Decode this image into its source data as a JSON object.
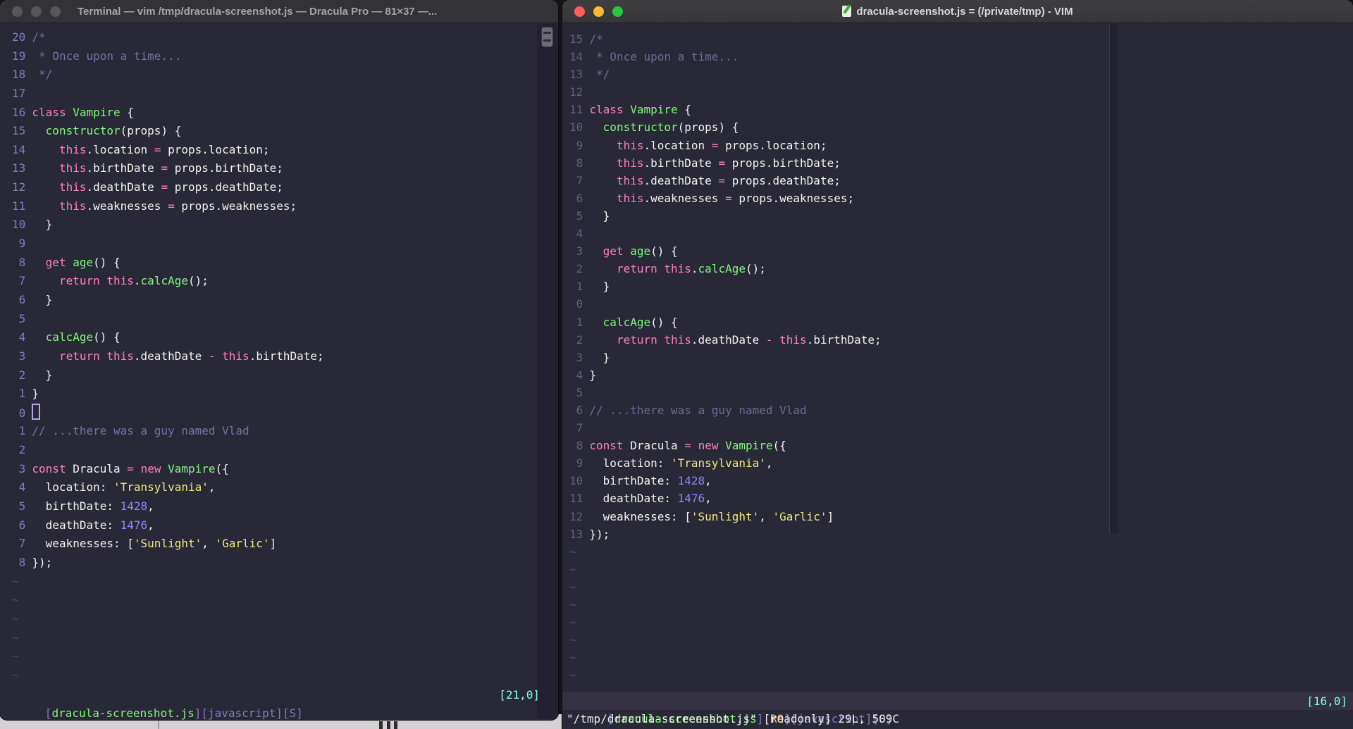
{
  "colors": {
    "background": "#292836",
    "foreground": "#F4F3EC",
    "pink": "#FF80BF",
    "green": "#82F77E",
    "yellow": "#EFEB7D",
    "purple_number": "#9580FF",
    "comment": "#7970A9",
    "cyan_ruler": "#80FFEA",
    "orange_readonly": "#FFCA80",
    "traffic_red": "#FF5F57",
    "traffic_yellow": "#FEBC2E",
    "traffic_green": "#28C840"
  },
  "code_lines": [
    [
      [
        "c",
        "/*"
      ]
    ],
    [
      [
        "c",
        " * Once upon a time..."
      ]
    ],
    [
      [
        "c",
        " */"
      ]
    ],
    [],
    [
      [
        "p",
        "class"
      ],
      [
        "f",
        " "
      ],
      [
        "g",
        "Vampire"
      ],
      [
        "f",
        " {"
      ]
    ],
    [
      [
        "f",
        "  "
      ],
      [
        "g",
        "constructor"
      ],
      [
        "f",
        "(props) {"
      ]
    ],
    [
      [
        "f",
        "    "
      ],
      [
        "p",
        "this"
      ],
      [
        "f",
        ".location "
      ],
      [
        "p",
        "="
      ],
      [
        "f",
        " props.location;"
      ]
    ],
    [
      [
        "f",
        "    "
      ],
      [
        "p",
        "this"
      ],
      [
        "f",
        ".birthDate "
      ],
      [
        "p",
        "="
      ],
      [
        "f",
        " props.birthDate;"
      ]
    ],
    [
      [
        "f",
        "    "
      ],
      [
        "p",
        "this"
      ],
      [
        "f",
        ".deathDate "
      ],
      [
        "p",
        "="
      ],
      [
        "f",
        " props.deathDate;"
      ]
    ],
    [
      [
        "f",
        "    "
      ],
      [
        "p",
        "this"
      ],
      [
        "f",
        ".weaknesses "
      ],
      [
        "p",
        "="
      ],
      [
        "f",
        " props.weaknesses;"
      ]
    ],
    [
      [
        "f",
        "  }"
      ]
    ],
    [],
    [
      [
        "f",
        "  "
      ],
      [
        "p",
        "get"
      ],
      [
        "f",
        " "
      ],
      [
        "g",
        "age"
      ],
      [
        "f",
        "() {"
      ]
    ],
    [
      [
        "f",
        "    "
      ],
      [
        "p",
        "return"
      ],
      [
        "f",
        " "
      ],
      [
        "p",
        "this"
      ],
      [
        "f",
        "."
      ],
      [
        "g",
        "calcAge"
      ],
      [
        "f",
        "();"
      ]
    ],
    [
      [
        "f",
        "  }"
      ]
    ],
    [],
    [
      [
        "f",
        "  "
      ],
      [
        "g",
        "calcAge"
      ],
      [
        "f",
        "() {"
      ]
    ],
    [
      [
        "f",
        "    "
      ],
      [
        "p",
        "return"
      ],
      [
        "f",
        " "
      ],
      [
        "p",
        "this"
      ],
      [
        "f",
        ".deathDate "
      ],
      [
        "p",
        "-"
      ],
      [
        "f",
        " "
      ],
      [
        "p",
        "this"
      ],
      [
        "f",
        ".birthDate;"
      ]
    ],
    [
      [
        "f",
        "  }"
      ]
    ],
    [
      [
        "f",
        "}"
      ]
    ],
    [],
    [
      [
        "c",
        "// ...there was a guy named Vlad"
      ]
    ],
    [],
    [
      [
        "p",
        "const"
      ],
      [
        "f",
        " Dracula "
      ],
      [
        "p",
        "="
      ],
      [
        "f",
        " "
      ],
      [
        "p",
        "new"
      ],
      [
        "f",
        " "
      ],
      [
        "g",
        "Vampire"
      ],
      [
        "f",
        "({"
      ]
    ],
    [
      [
        "f",
        "  location: "
      ],
      [
        "y",
        "'Transylvania'"
      ],
      [
        "f",
        ","
      ]
    ],
    [
      [
        "f",
        "  birthDate: "
      ],
      [
        "n",
        "1428"
      ],
      [
        "f",
        ","
      ]
    ],
    [
      [
        "f",
        "  deathDate: "
      ],
      [
        "n",
        "1476"
      ],
      [
        "f",
        ","
      ]
    ],
    [
      [
        "f",
        "  weaknesses: ["
      ],
      [
        "y",
        "'Sunlight'"
      ],
      [
        "f",
        ", "
      ],
      [
        "y",
        "'Garlic'"
      ],
      [
        "f",
        "]"
      ]
    ],
    [
      [
        "f",
        "});"
      ]
    ]
  ],
  "left_window": {
    "title": "Terminal — vim /tmp/dracula-screenshot.js — Dracula Pro — 81×37 —...",
    "cursor_file_line": 21,
    "show_cursor": true,
    "tilde_count": 6,
    "status_tokens": [
      [
        "b",
        "["
      ],
      [
        "g",
        "dracula-screenshot.js"
      ],
      [
        "b",
        "]["
      ],
      [
        "j",
        "javascript"
      ],
      [
        "b",
        "]["
      ],
      [
        "j",
        "S"
      ],
      [
        "b",
        "]"
      ]
    ],
    "ruler_tokens": [
      [
        "cy",
        "[21,0]"
      ]
    ],
    "cmdline": ""
  },
  "right_window": {
    "title": "dracula-screenshot.js = (/private/tmp) - VIM",
    "cursor_file_line": 16,
    "show_cursor": false,
    "tilde_count": 8,
    "status_tokens": [
      [
        "b",
        "["
      ],
      [
        "g",
        "dracula-screenshot.js"
      ],
      [
        "b",
        "]["
      ],
      [
        "o",
        "RO"
      ],
      [
        "b",
        "]["
      ],
      [
        "j",
        "javascript"
      ],
      [
        "b",
        "]["
      ],
      [
        "j",
        "S"
      ],
      [
        "b",
        "]"
      ]
    ],
    "ruler_tokens": [
      [
        "cy",
        "[16,0]"
      ]
    ],
    "cmdline": "\"/tmp/dracula-screenshot.js\" [readonly] 29L, 509C"
  }
}
